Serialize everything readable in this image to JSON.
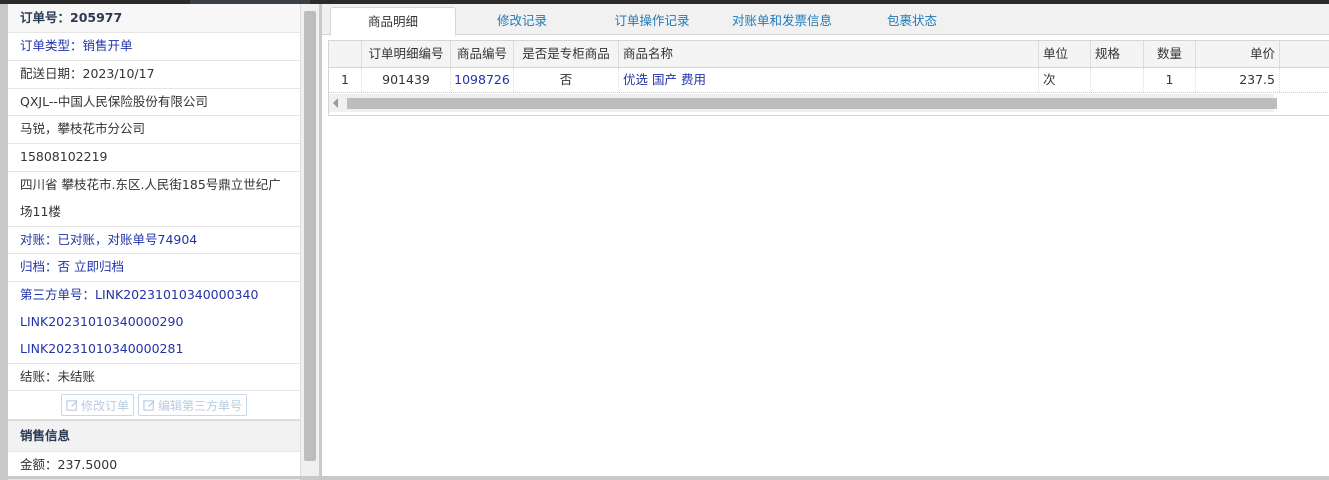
{
  "order_panel": {
    "order_no": "订单号：205977",
    "order_type": "订单类型：销售开单",
    "delivery_date": "配送日期：2023/10/17",
    "company": "QXJL--中国人民保险股份有限公司",
    "contact": "马锐，攀枝花市分公司",
    "phone": "15808102219",
    "address_line1": "四川省 攀枝花市.东区.人民街185号鼎立世纪广",
    "address_line2": "场11楼",
    "reconcile": "对账：已对账，对账单号74904",
    "archive": "归档：否 立即归档",
    "third_party_1": "第三方单号：LINK20231010340000340",
    "third_party_2": "LINK20231010340000290",
    "third_party_3": "LINK20231010340000281",
    "settlement": "结账：未结账",
    "edit_order_button": "修改订单",
    "edit_third_party_button": "编辑第三方单号",
    "sales_info_title": "销售信息",
    "amount": "金额：237.5000"
  },
  "tabs": [
    {
      "label": "商品明细",
      "active": true
    },
    {
      "label": "修改记录"
    },
    {
      "label": "订单操作记录"
    },
    {
      "label": "对账单和发票信息"
    },
    {
      "label": "包裹状态"
    }
  ],
  "table": {
    "columns": [
      "",
      "订单明细编号",
      "商品编号",
      "是否是专柜商品",
      "商品名称",
      "单位",
      "规格",
      "数量",
      "单价"
    ],
    "rows": [
      {
        "index": "1",
        "detail_no": "901439",
        "product_no": "1098726",
        "counter": "否",
        "name": "优选 国产 费用",
        "unit": "次",
        "spec": "",
        "qty": "1",
        "price": "237.5"
      }
    ]
  },
  "colors": {
    "link": "#2233aa",
    "tab_text": "#1e7ab8",
    "header_text": "#2a3a55"
  }
}
